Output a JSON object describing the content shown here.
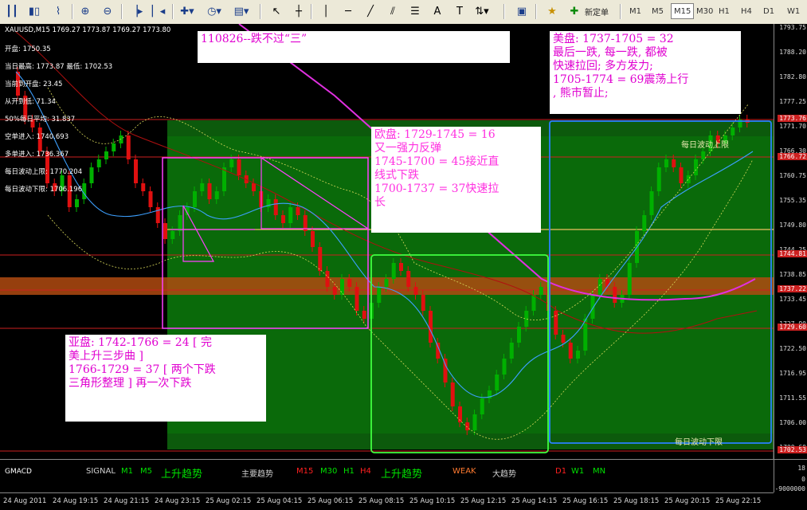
{
  "toolbar": {
    "new_order_label": "新定单",
    "timeframes": [
      "M1",
      "M5",
      "M15",
      "M30",
      "H1",
      "H4",
      "D1",
      "W1"
    ],
    "active_timeframe": "M15"
  },
  "chart": {
    "header": "XAUUSD,M15  1769.27 1773.87 1769.27 1773.80",
    "info_lines": [
      "开盘: 1750.35",
      "当日最高: 1773.87   最低: 1702.53",
      "当前到开盘: 23.45",
      "从开到低: 71.34",
      "50%每日平均: 31.837",
      "空单进入: 1740.693",
      "多单进入: 1736.367",
      "每日波动上限: 1770.204",
      "每日波动下限: 1706.196"
    ],
    "price_ticks": [
      "1793.75",
      "1788.20",
      "1782.80",
      "1777.25",
      "1771.70",
      "1766.30",
      "1760.75",
      "1755.35",
      "1749.80",
      "1744.25",
      "1738.85",
      "1733.45",
      "1727.90",
      "1722.50",
      "1716.95",
      "1711.55",
      "1706.00",
      "1700.60"
    ],
    "highlight_prices": [
      {
        "label": "1773.76",
        "color": "#cc2020"
      },
      {
        "label": "1766.72",
        "color": "#cc2020"
      },
      {
        "label": "1744.81",
        "color": "#cc2020"
      },
      {
        "label": "1737.22",
        "color": "#cc2020"
      },
      {
        "label": "1729.60",
        "color": "#cc2020"
      },
      {
        "label": "1702.53",
        "color": "#cc2020"
      }
    ],
    "time_ticks": [
      "24 Aug 2011",
      "24 Aug 19:15",
      "24 Aug 21:15",
      "24 Aug 23:15",
      "25 Aug 02:15",
      "25 Aug 04:15",
      "25 Aug 06:15",
      "25 Aug 08:15",
      "25 Aug 10:15",
      "25 Aug 12:15",
      "25 Aug 14:15",
      "25 Aug 16:15",
      "25 Aug 18:15",
      "25 Aug 20:15",
      "25 Aug 22:15"
    ],
    "upper_band_label": "每日波动上限",
    "lower_band_label": "每日波动下限",
    "sub_axis": [
      "18",
      "0",
      "-9000000"
    ],
    "colors": {
      "bull": "#00b000",
      "bear": "#e01010",
      "band": "#0a6a0a",
      "accent": "#ff40ff"
    }
  },
  "notes": {
    "top_title": "110826--跌不过“三”",
    "us": "美盘: 1737-1705 = 32\n最后一跌, 每一跌, 都被\n快速拉回; 多方发力;\n1705-1774 = 69震荡上行\n, 熊市暂止;",
    "eu": "欧盘: 1729-1745 = 16\n又一强力反弹\n1745-1700 = 45接近直\n线式下跌\n1700-1737 = 37快速拉\n长",
    "asia": "亚盘: 1742-1766 = 24 [ 完\n美上升三步曲 ]\n1766-1729 = 37 [ 两个下跌\n三角形整理 ] 再一次下跌"
  },
  "indicator": {
    "name": "GMACD",
    "items": [
      {
        "text": "SIGNAL",
        "color": "#d0d0d0",
        "big": false
      },
      {
        "text": "M1",
        "color": "#00e000",
        "big": false
      },
      {
        "text": "M5",
        "color": "#00e000",
        "big": false
      },
      {
        "text": "上升趋势",
        "color": "#00e000",
        "big": true
      },
      {
        "text": "主要趋势",
        "color": "#d0d0d0",
        "big": false
      },
      {
        "text": "M15",
        "color": "#ff2020",
        "big": false
      },
      {
        "text": "M30",
        "color": "#00e000",
        "big": false
      },
      {
        "text": "H1",
        "color": "#00e000",
        "big": false
      },
      {
        "text": "H4",
        "color": "#ff2020",
        "big": false
      },
      {
        "text": "上升趋势",
        "color": "#00e000",
        "big": true
      },
      {
        "text": "WEAK",
        "color": "#ff7a30",
        "big": false
      },
      {
        "text": "大趋势",
        "color": "#d0d0d0",
        "big": false
      },
      {
        "text": "D1",
        "color": "#ff2020",
        "big": false
      },
      {
        "text": "W1",
        "color": "#00e000",
        "big": false
      },
      {
        "text": "MN",
        "color": "#00e000",
        "big": false
      }
    ]
  }
}
